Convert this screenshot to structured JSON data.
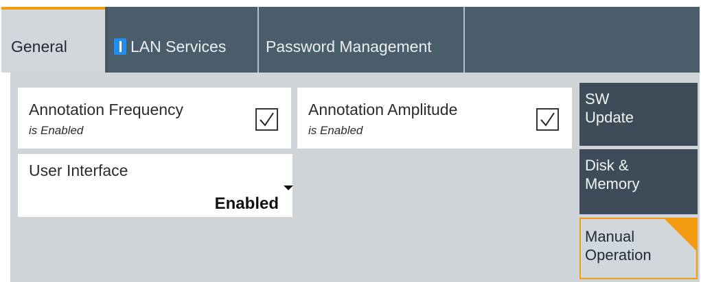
{
  "tabs": [
    {
      "label": "General",
      "active": true
    },
    {
      "label": "LAN Services",
      "active": false
    },
    {
      "label": "Password Management",
      "active": false
    }
  ],
  "panels": {
    "annotation_frequency": {
      "title": "Annotation Frequency",
      "status": "is Enabled",
      "checked": true
    },
    "annotation_amplitude": {
      "title": "Annotation Amplitude",
      "status": "is Enabled",
      "checked": true
    },
    "user_interface": {
      "title": "User Interface",
      "value": "Enabled"
    }
  },
  "side_buttons": [
    {
      "label": "SW\nUpdate"
    },
    {
      "label": "Disk &\nMemory"
    },
    {
      "label": "Manual\nOperation",
      "active": true
    }
  ],
  "colors": {
    "accent": "#f39c12",
    "tab_dark": "#4a5d6b",
    "tab_active": "#d2d7db",
    "side_button": "#3d4c58",
    "lan_indicator": "#1e8ef0"
  }
}
